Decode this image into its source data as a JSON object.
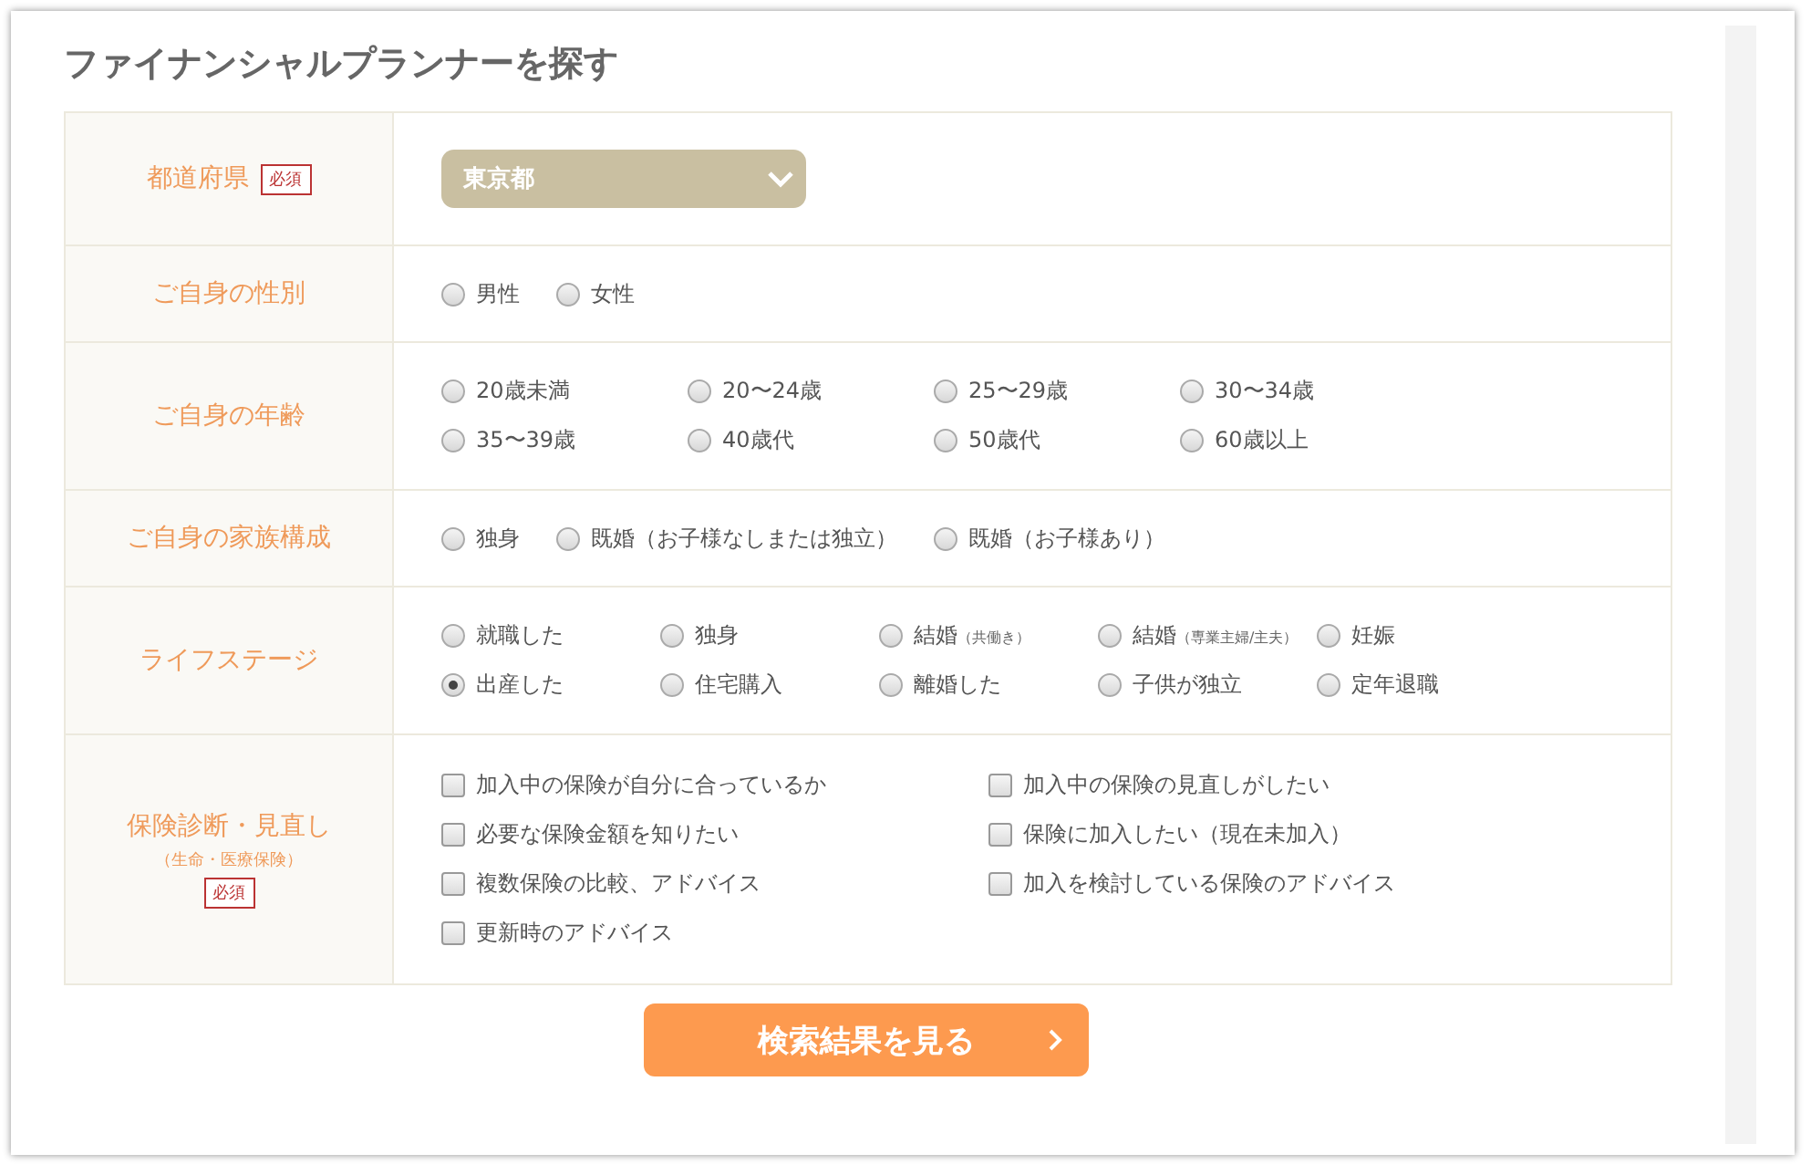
{
  "title": "ファイナンシャルプランナーを探す",
  "rows": [
    {
      "label": "都道府県",
      "required": true,
      "required_label": "必須",
      "kind": "select",
      "value": "東京都"
    },
    {
      "label": "ご自身の性別",
      "required": false,
      "kind": "radio",
      "options": [
        {
          "text": "男性",
          "selected": false
        },
        {
          "text": "女性",
          "selected": false
        }
      ]
    },
    {
      "label": "ご自身の年齢",
      "required": false,
      "kind": "radio",
      "options": [
        {
          "text": "20歳未満",
          "selected": false
        },
        {
          "text": "20〜24歳",
          "selected": false
        },
        {
          "text": "25〜29歳",
          "selected": false
        },
        {
          "text": "30〜34歳",
          "selected": false
        },
        {
          "text": "35〜39歳",
          "selected": false
        },
        {
          "text": "40歳代",
          "selected": false
        },
        {
          "text": "50歳代",
          "selected": false
        },
        {
          "text": "60歳以上",
          "selected": false
        }
      ]
    },
    {
      "label": "ご自身の家族構成",
      "required": false,
      "kind": "radio",
      "options": [
        {
          "text": "独身",
          "selected": false
        },
        {
          "text": "既婚（お子様なしまたは独立）",
          "selected": false
        },
        {
          "text": "既婚（お子様あり）",
          "selected": false
        }
      ]
    },
    {
      "label": "ライフステージ",
      "required": false,
      "kind": "radio",
      "options": [
        {
          "text": "就職した",
          "selected": false
        },
        {
          "text": "独身",
          "selected": false
        },
        {
          "text": "結婚",
          "note": "（共働き）",
          "selected": false
        },
        {
          "text": "結婚",
          "note": "（専業主婦/主夫）",
          "selected": false
        },
        {
          "text": "妊娠",
          "selected": false
        },
        {
          "text": "出産した",
          "selected": true
        },
        {
          "text": "住宅購入",
          "selected": false
        },
        {
          "text": "離婚した",
          "selected": false
        },
        {
          "text": "子供が独立",
          "selected": false
        },
        {
          "text": "定年退職",
          "selected": false
        }
      ]
    },
    {
      "label": "保険診断・見直し",
      "sublabel": "（生命・医療保険）",
      "required": true,
      "required_label": "必須",
      "kind": "checkbox",
      "options": [
        {
          "text": "加入中の保険が自分に合っているか",
          "checked": false
        },
        {
          "text": "加入中の保険の見直しがしたい",
          "checked": false
        },
        {
          "text": "必要な保険金額を知りたい",
          "checked": false
        },
        {
          "text": "保険に加入したい（現在未加入）",
          "checked": false
        },
        {
          "text": "複数保険の比較、アドバイス",
          "checked": false
        },
        {
          "text": "加入を検討している保険のアドバイス",
          "checked": false
        },
        {
          "text": "更新時のアドバイス",
          "checked": false
        }
      ]
    }
  ],
  "submit": {
    "label": "検索結果を見る"
  }
}
